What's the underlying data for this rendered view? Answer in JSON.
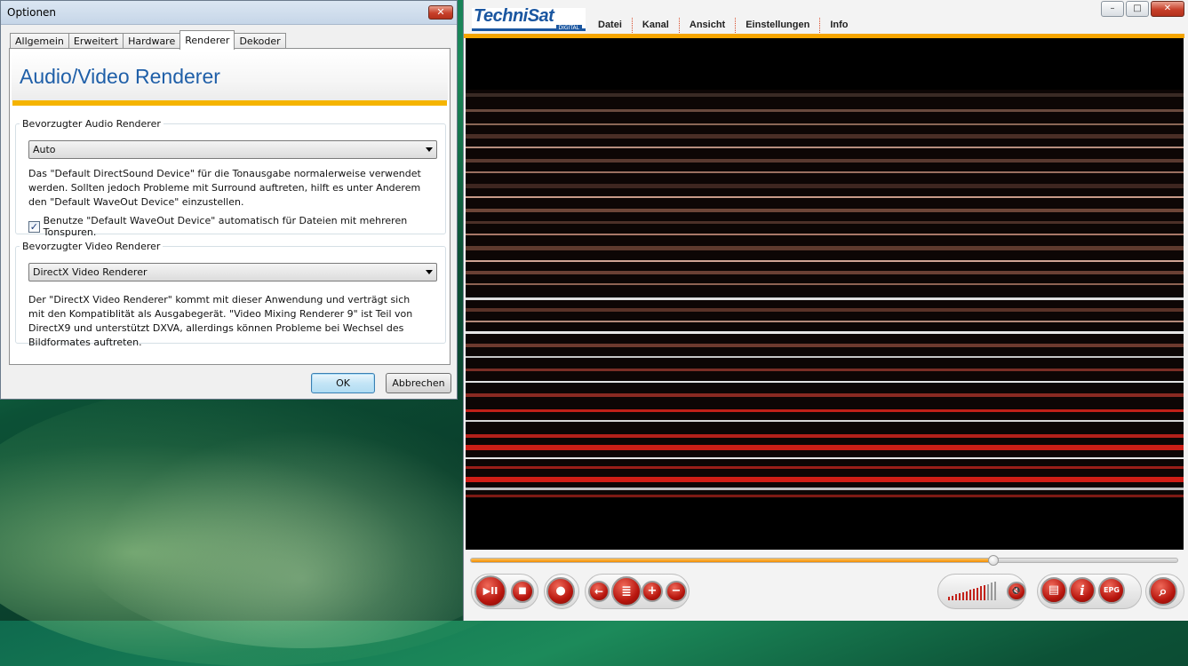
{
  "dialog": {
    "title": "Optionen",
    "close_glyph": "✕",
    "tabs": [
      {
        "label": "Allgemein"
      },
      {
        "label": "Erweitert"
      },
      {
        "label": "Hardware"
      },
      {
        "label": "Renderer"
      },
      {
        "label": "Dekoder"
      }
    ],
    "active_tab": "Renderer",
    "heading": "Audio/Video Renderer",
    "audio": {
      "legend": "Bevorzugter Audio Renderer",
      "selected": "Auto",
      "description": "Das \"Default DirectSound Device\" für die Tonausgabe normalerweise verwendet werden. Sollten jedoch Probleme mit Surround auftreten, hilft es unter Anderem den \"Default WaveOut Device\" einzustellen.",
      "checkbox_label": "Benutze \"Default WaveOut Device\" automatisch für Dateien mit mehreren Tonspuren.",
      "checkbox_checked": true,
      "check_glyph": "✓"
    },
    "video": {
      "legend": "Bevorzugter Video Renderer",
      "selected": "DirectX Video Renderer",
      "description": "Der \"DirectX Video Renderer\" kommt mit dieser Anwendung und verträgt sich mit den Kompatiblität als Ausgabegerät. \"Video Mixing Renderer 9\" ist Teil von DirectX9 und unterstützt DXVA, allerdings können Probleme bei Wechsel des Bildformates auftreten."
    },
    "ok_label": "OK",
    "cancel_label": "Abbrechen"
  },
  "player": {
    "logo": "TechniSat",
    "logo_sub": "DIGITAL",
    "menu": [
      "Datei",
      "Kanal",
      "Ansicht",
      "Einstellungen",
      "Info"
    ],
    "window_buttons": {
      "minimize": "–",
      "maximize": "□",
      "close": "✕"
    },
    "seek_progress": 0.74,
    "volume_level": 0.75,
    "controls": {
      "play_pause": "▶II",
      "stop": "■",
      "record": "●",
      "back": "←",
      "channel_list": "≣",
      "plus": "+",
      "minus": "−",
      "mute": "🔇",
      "teletext": "▤",
      "info": "i",
      "epg": "EPG",
      "search": "⌕"
    },
    "accent_color": "#f5a500",
    "button_color": "#c01a12"
  }
}
